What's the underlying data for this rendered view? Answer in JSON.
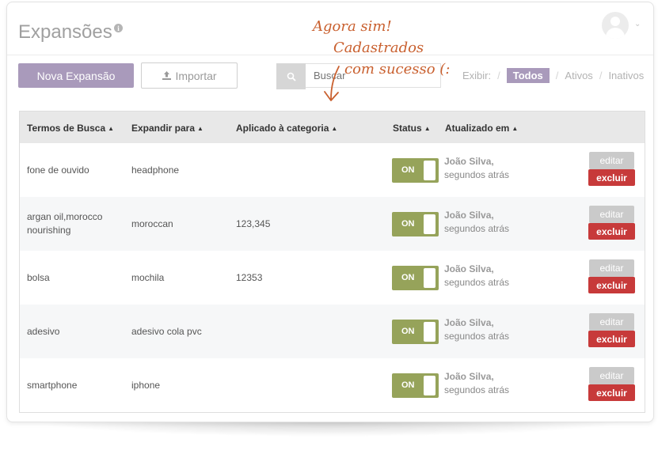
{
  "header": {
    "title": "Expansões",
    "info_icon": "i"
  },
  "toolbar": {
    "new_label": "Nova Expansão",
    "import_label": "Importar",
    "search_placeholder": "Buscar",
    "filter_label": "Exibir:",
    "filters": [
      "Todos",
      "Ativos",
      "Inativos"
    ],
    "active_filter": "Todos"
  },
  "annotation": {
    "lines": [
      "Agora sim!",
      "Cadastrados",
      "com sucesso (:"
    ]
  },
  "table": {
    "columns": [
      "Termos de Busca",
      "Expandir para",
      "Aplicado à categoria",
      "Status",
      "Atualizado em"
    ],
    "rows": [
      {
        "term": "fone de ouvido",
        "expand": "headphone",
        "category": "",
        "status": "ON",
        "user": "João Silva,",
        "time": "segundos atrás"
      },
      {
        "term": "argan oil,morocco nourishing",
        "expand": "moroccan",
        "category": "123,345",
        "status": "ON",
        "user": "João Silva,",
        "time": "segundos atrás"
      },
      {
        "term": "bolsa",
        "expand": "mochila",
        "category": "12353",
        "status": "ON",
        "user": "João Silva,",
        "time": "segundos atrás"
      },
      {
        "term": "adesivo",
        "expand": "adesivo cola pvc",
        "category": "",
        "status": "ON",
        "user": "João Silva,",
        "time": "segundos atrás"
      },
      {
        "term": "smartphone",
        "expand": "iphone",
        "category": "",
        "status": "ON",
        "user": "João Silva,",
        "time": "segundos atrás"
      }
    ],
    "edit_label": "editar",
    "delete_label": "excluir"
  },
  "colors": {
    "primary": "#a99abb",
    "toggle_on": "#96a35a",
    "danger": "#c73a3a",
    "annotation": "#c9602f"
  }
}
